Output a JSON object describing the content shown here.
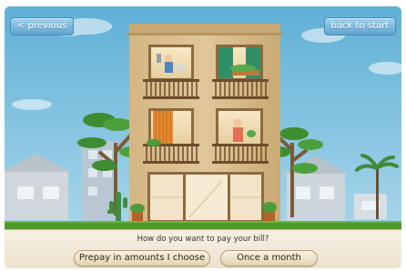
{
  "navigation": {
    "previous_label": "< previous",
    "back_label": "back to start"
  },
  "question": {
    "text": "How do you want to pay your bill?"
  },
  "choices": [
    {
      "label": "Prepay in amounts I choose"
    },
    {
      "label": "Once a month"
    }
  ],
  "colors": {
    "sky": "#6fb8d9",
    "building": "#d8bd8e",
    "grass": "#4d9a2a",
    "panel": "#f3ecdc",
    "button_blue": "#69abd4"
  }
}
